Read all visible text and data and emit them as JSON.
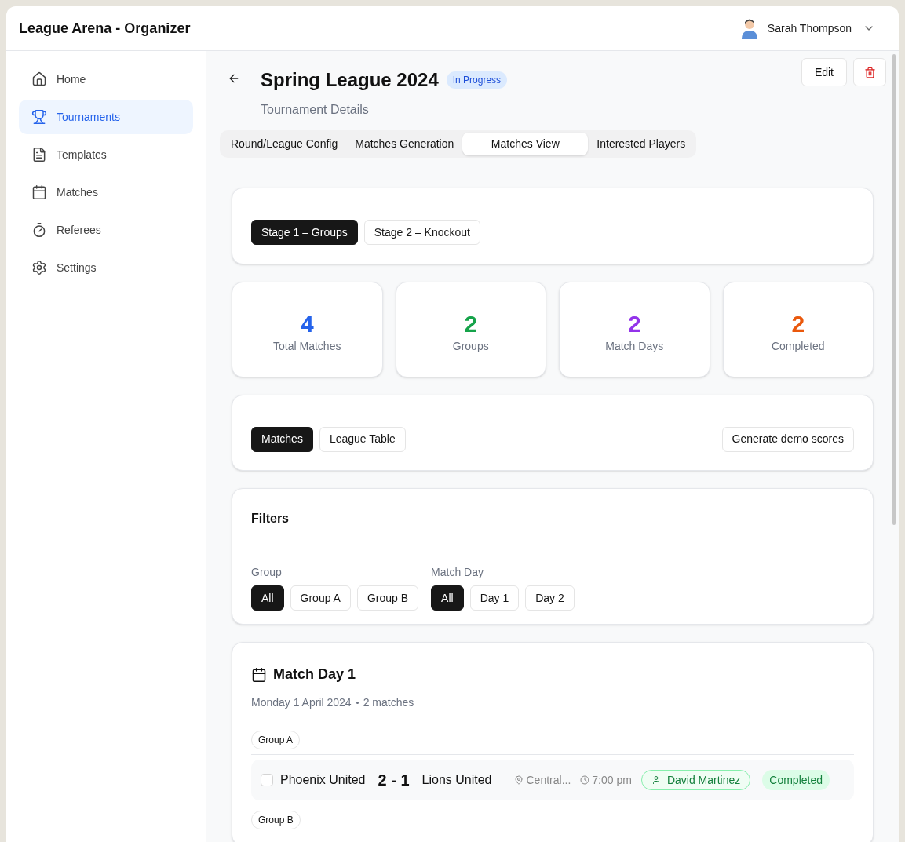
{
  "app": {
    "title": "League Arena - Organizer"
  },
  "user": {
    "name": "Sarah Thompson"
  },
  "sidebar": {
    "items": [
      {
        "label": "Home",
        "kind": "home",
        "selected": false
      },
      {
        "label": "Tournaments",
        "kind": "trophy",
        "selected": true
      },
      {
        "label": "Templates",
        "kind": "file",
        "selected": false
      },
      {
        "label": "Matches",
        "kind": "calendar",
        "selected": false
      },
      {
        "label": "Referees",
        "kind": "timer",
        "selected": false
      },
      {
        "label": "Settings",
        "kind": "settings",
        "selected": false
      }
    ]
  },
  "header": {
    "title": "Spring League 2024",
    "status": "In Progress",
    "subtitle": "Tournament Details",
    "edit_button": "Edit"
  },
  "tabs": [
    {
      "label": "Round/League Config",
      "selected": false
    },
    {
      "label": "Matches Generation",
      "selected": false
    },
    {
      "label": "Matches View",
      "selected": true
    },
    {
      "label": "Interested Players",
      "selected": false
    }
  ],
  "stages": [
    {
      "label": "Stage 1 – Groups",
      "selected": true
    },
    {
      "label": "Stage 2 – Knockout",
      "selected": false
    }
  ],
  "stats": [
    {
      "value": "4",
      "label": "Total Matches",
      "color": "#2563eb"
    },
    {
      "value": "2",
      "label": "Groups",
      "color": "#16a34a"
    },
    {
      "value": "2",
      "label": "Match Days",
      "color": "#9333ea"
    },
    {
      "value": "2",
      "label": "Completed",
      "color": "#ea580c"
    }
  ],
  "view_toggle": [
    {
      "label": "Matches",
      "selected": true
    },
    {
      "label": "League Table",
      "selected": false
    }
  ],
  "demo_button": "Generate demo scores",
  "filters": {
    "title": "Filters",
    "groups": [
      {
        "label": "Group",
        "options": [
          {
            "label": "All",
            "selected": true
          },
          {
            "label": "Group A",
            "selected": false
          },
          {
            "label": "Group B",
            "selected": false
          }
        ]
      },
      {
        "label": "Match Day",
        "options": [
          {
            "label": "All",
            "selected": true
          },
          {
            "label": "Day 1",
            "selected": false
          },
          {
            "label": "Day 2",
            "selected": false
          }
        ]
      }
    ]
  },
  "match_day": {
    "title": "Match Day 1",
    "date": "Monday 1 April 2024",
    "count": "2 matches",
    "groups": [
      {
        "label": "Group A",
        "matches": [
          {
            "home": "Phoenix United",
            "score": "2 - 1",
            "away": "Lions United",
            "venue": "Central...",
            "time": "7:00 pm",
            "referee": "David Martinez",
            "status": "Completed",
            "checked": false
          }
        ]
      },
      {
        "label": "Group B"
      }
    ]
  }
}
